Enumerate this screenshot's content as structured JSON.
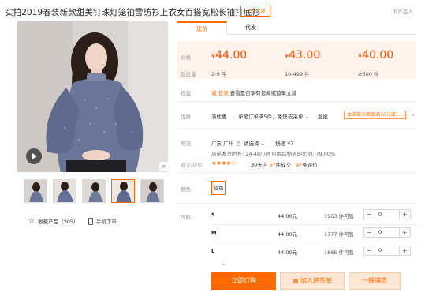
{
  "product": {
    "title": "实拍2019春装新款甜美钉珠灯笼袖雪纺衫上衣女百搭宽松长袖打底衫",
    "badge": "一件代发",
    "not_product_link": "非产品人"
  },
  "gallery": {
    "favorites_label": "收藏产品（205）",
    "mobile_label": "手机下单",
    "thumbnail_count": 5
  },
  "tabs": [
    {
      "label": "现货"
    },
    {
      "label": "代发"
    }
  ],
  "pricing": {
    "price_label": "价格",
    "qty_label": "起批量",
    "currency": "¥",
    "tiers": [
      {
        "price": "44.00",
        "qty": "2-9 件"
      },
      {
        "price": "43.00",
        "qty": "10-499 件"
      },
      {
        "price": "40.00",
        "qty": "≥500 件"
      }
    ]
  },
  "benefits": {
    "label": "权益",
    "badge": "诚",
    "link": "登录",
    "text": "查看是否享有包邮或首单立减"
  },
  "promo": {
    "label": "优惠",
    "tag1": "满优惠",
    "text1": "单笔订单满5件，免快...",
    "more": "去采单",
    "tag2": "混批",
    "text2": "本店部分商品满10元或1..."
  },
  "logistics": {
    "label": "物流",
    "origin": "广东 广州",
    "to_word": "至",
    "destination": "请选择",
    "express": "快递 ¥7",
    "ship_promise": "承诺发货时长: 24-48小时",
    "fulfil_rate": "可跟踪物流的比例: 79.00%"
  },
  "rating": {
    "label": "成交/评价",
    "stars": "★★★★☆",
    "deals_prefix": "30天内",
    "deals_count": "57",
    "deals_suffix": "件成交",
    "reviews_count": "97",
    "reviews_suffix": "条评价"
  },
  "color": {
    "label": "颜色",
    "option": "蓝色"
  },
  "sizes": {
    "label": "尺码",
    "rows": [
      {
        "name": "S",
        "price": "44.00元",
        "stock": "1963 件可售",
        "qty": "0"
      },
      {
        "name": "M",
        "price": "44.00元",
        "stock": "1777 件可售",
        "qty": "0"
      },
      {
        "name": "L",
        "price": "44.00元",
        "stock": "1865 件可售",
        "qty": "0"
      }
    ]
  },
  "actions": {
    "buy": "立即订购",
    "cart": "加入进货单",
    "oneclick": "一键铺货"
  },
  "colors": {
    "accent": "#ff6a00",
    "price": "#ff5000",
    "price_band": "#fff3eb"
  }
}
